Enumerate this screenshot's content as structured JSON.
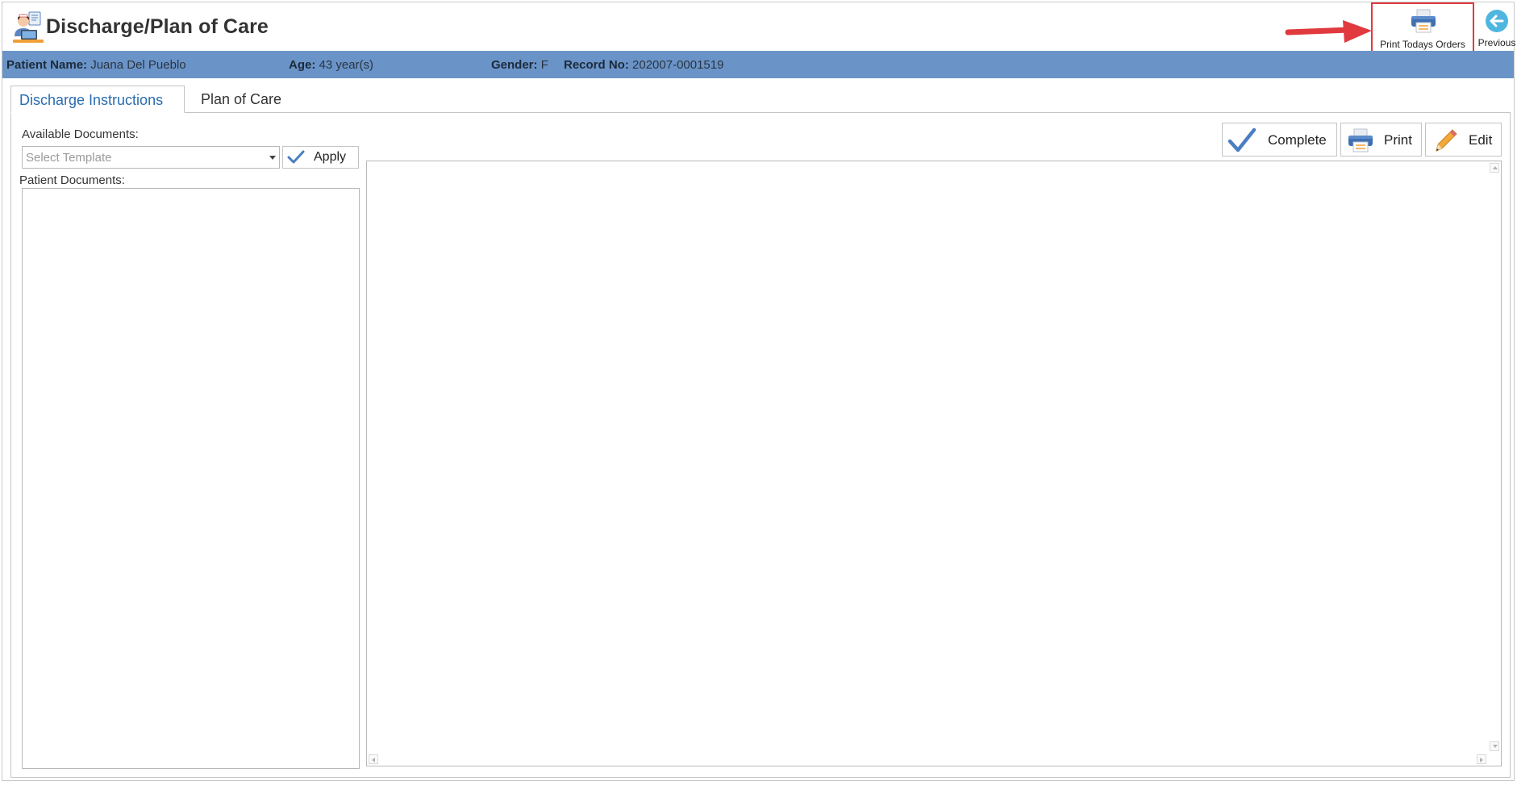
{
  "window": {
    "title": "Discharge/Plan of Care"
  },
  "toolbar": {
    "print_todays_orders": "Print Todays Orders",
    "previous": "Previous"
  },
  "patient": {
    "name_label": "Patient Name:",
    "name": "Juana Del Pueblo",
    "age_label": "Age:",
    "age": "43 year(s)",
    "gender_label": "Gender:",
    "gender": "F",
    "record_label": "Record No:",
    "record_no": "202007-0001519"
  },
  "tabs": [
    {
      "label": "Discharge Instructions",
      "active": true
    },
    {
      "label": "Plan of Care",
      "active": false
    }
  ],
  "left_panel": {
    "available_documents_label": "Available Documents:",
    "template_select": {
      "placeholder": "Select Template",
      "value": ""
    },
    "apply_label": "Apply",
    "patient_documents_label": "Patient Documents:",
    "patient_documents": []
  },
  "editor_toolbar": {
    "complete_label": "Complete",
    "print_label": "Print",
    "edit_label": "Edit"
  },
  "colors": {
    "patient_bar": "#6a94c8",
    "tab_active_text": "#2b6cb0",
    "annotation_red": "#e03a3e",
    "previous_circle": "#4fb6e0",
    "check_blue": "#4a7ec0"
  },
  "icons": {
    "app": "nurse-workstation-icon",
    "print_todays_orders": "printer-icon",
    "previous": "arrow-left-circle-icon",
    "apply": "checkmark-icon",
    "complete": "checkmark-icon",
    "print": "printer-icon",
    "edit": "pencil-icon"
  }
}
